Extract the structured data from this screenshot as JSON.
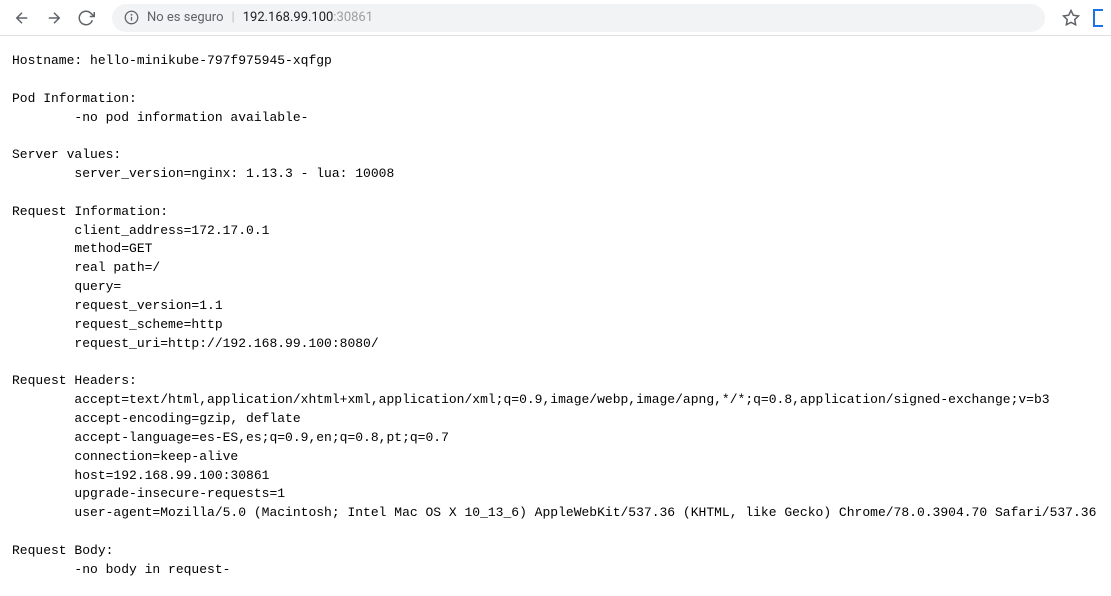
{
  "toolbar": {
    "insecure_label": "No es seguro",
    "url_host": "192.168.99.100",
    "url_port": ":30861"
  },
  "page": {
    "hostname_line": "Hostname: hello-minikube-797f975945-xqfgp",
    "pod_header": "Pod Information:",
    "pod_info": "        -no pod information available-",
    "server_header": "Server values:",
    "server_values": "        server_version=nginx: 1.13.3 - lua: 10008",
    "req_info_header": "Request Information:",
    "req_info_lines": "        client_address=172.17.0.1\n        method=GET\n        real path=/\n        query=\n        request_version=1.1\n        request_scheme=http\n        request_uri=http://192.168.99.100:8080/",
    "req_headers_header": "Request Headers:",
    "req_headers_lines": "        accept=text/html,application/xhtml+xml,application/xml;q=0.9,image/webp,image/apng,*/*;q=0.8,application/signed-exchange;v=b3\n        accept-encoding=gzip, deflate\n        accept-language=es-ES,es;q=0.9,en;q=0.8,pt;q=0.7\n        connection=keep-alive\n        host=192.168.99.100:30861\n        upgrade-insecure-requests=1\n        user-agent=Mozilla/5.0 (Macintosh; Intel Mac OS X 10_13_6) AppleWebKit/537.36 (KHTML, like Gecko) Chrome/78.0.3904.70 Safari/537.36",
    "req_body_header": "Request Body:",
    "req_body_lines": "        -no body in request-"
  }
}
